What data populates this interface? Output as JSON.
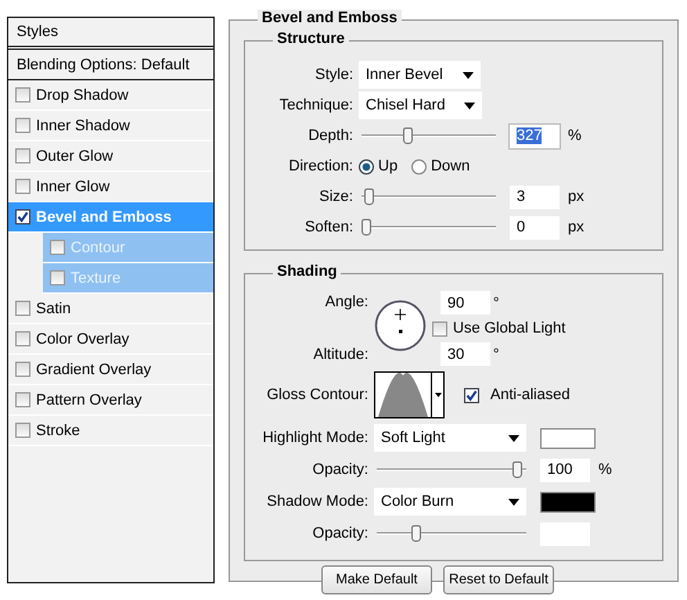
{
  "sidebar": {
    "header": "Styles",
    "items": [
      {
        "label": "Blending Options: Default",
        "kind": "plain",
        "selected": false
      },
      {
        "label": "Drop Shadow",
        "kind": "check",
        "checked": false,
        "selected": false
      },
      {
        "label": "Inner Shadow",
        "kind": "check",
        "checked": false,
        "selected": false
      },
      {
        "label": "Outer Glow",
        "kind": "check",
        "checked": false,
        "selected": false
      },
      {
        "label": "Inner Glow",
        "kind": "check",
        "checked": false,
        "selected": false
      },
      {
        "label": "Bevel and Emboss",
        "kind": "check",
        "checked": true,
        "selected": true,
        "children": [
          {
            "label": "Contour",
            "checked": false,
            "selected": false
          },
          {
            "label": "Texture",
            "checked": false,
            "selected": false
          }
        ]
      },
      {
        "label": "Satin",
        "kind": "check",
        "checked": false,
        "selected": false
      },
      {
        "label": "Color Overlay",
        "kind": "check",
        "checked": false,
        "selected": false
      },
      {
        "label": "Gradient Overlay",
        "kind": "check",
        "checked": false,
        "selected": false
      },
      {
        "label": "Pattern Overlay",
        "kind": "check",
        "checked": false,
        "selected": false
      },
      {
        "label": "Stroke",
        "kind": "check",
        "checked": false,
        "selected": false
      }
    ]
  },
  "panel": {
    "title": "Bevel and Emboss",
    "structure": {
      "title": "Structure",
      "rows": [
        {
          "kind": "dropdown",
          "label": "Style:",
          "value": "Inner Bevel"
        },
        {
          "kind": "dropdown",
          "label": "Technique:",
          "value": "Chisel Hard"
        },
        {
          "kind": "slider",
          "label": "Depth:",
          "level": 0.33,
          "value": "327",
          "unit": "%",
          "value_selected": true
        },
        {
          "kind": "radio",
          "label": "Direction:",
          "options": [
            {
              "label": "Up",
              "selected": true
            },
            {
              "label": "Down",
              "selected": false
            }
          ]
        },
        {
          "kind": "slider",
          "label": "Size:",
          "level": 0.02,
          "value": "3",
          "unit": "px",
          "value_selected": false
        },
        {
          "kind": "slider",
          "label": "Soften:",
          "level": 0,
          "value": "0",
          "unit": "px",
          "value_selected": false
        }
      ]
    },
    "shading": {
      "title": "Shading",
      "angle": {
        "label": "Angle:",
        "value": "90",
        "unit": "°"
      },
      "global_light": {
        "label": "Use Global Light",
        "checked": false
      },
      "altitude": {
        "label": "Altitude:",
        "value": "30",
        "unit": "°"
      },
      "gloss_contour": {
        "label": "Gloss Contour:"
      },
      "anti_aliased": {
        "label": "Anti-aliased",
        "checked": true
      },
      "modes": [
        {
          "kind": "mode",
          "label": "Highlight Mode:",
          "value": "Soft Light",
          "color": "#ffffff"
        },
        {
          "kind": "slider",
          "label": "Opacity:",
          "level": 1,
          "value": "100",
          "unit": "%"
        },
        {
          "kind": "mode",
          "label": "Shadow Mode:",
          "value": "Color Burn",
          "color": "#000000"
        },
        {
          "kind": "slider",
          "label": "Opacity:",
          "level": 0.26
        }
      ]
    },
    "buttons": [
      "Make Default",
      "Reset to Default"
    ]
  }
}
